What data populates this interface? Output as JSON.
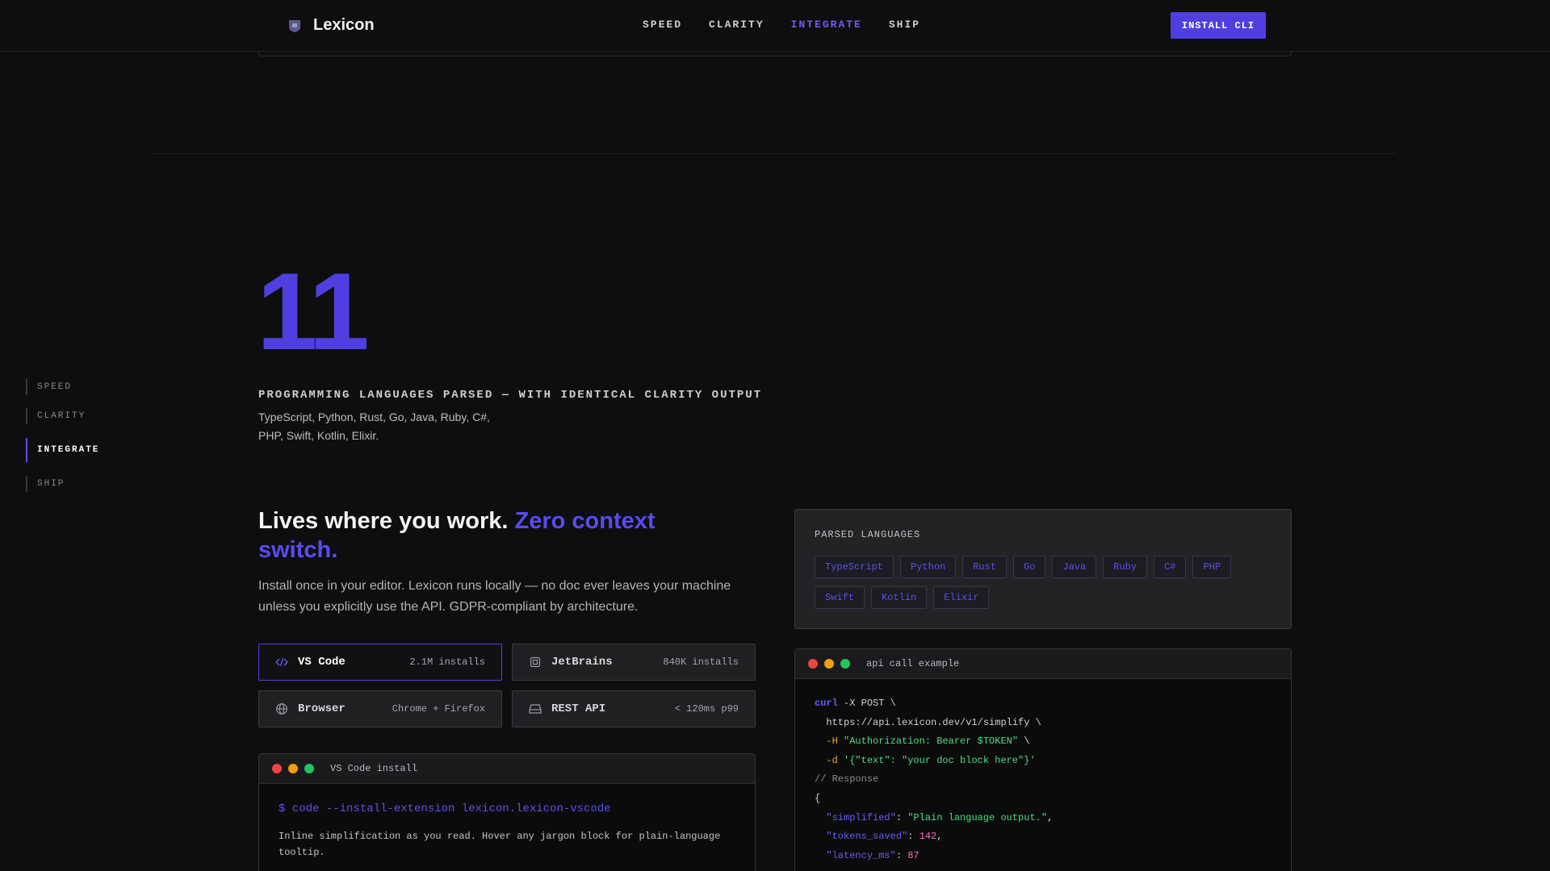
{
  "header": {
    "brand": "Lexicon",
    "nav": [
      "SPEED",
      "CLARITY",
      "INTEGRATE",
      "SHIP"
    ],
    "active_nav": "INTEGRATE",
    "cta": "INSTALL CLI"
  },
  "sidenav": {
    "items": [
      "SPEED",
      "CLARITY",
      "INTEGRATE",
      "SHIP"
    ],
    "active": "INTEGRATE"
  },
  "stat": {
    "number": "11",
    "label": "PROGRAMMING LANGUAGES PARSED — WITH IDENTICAL CLARITY OUTPUT",
    "desc_line1": "TypeScript, Python, Rust, Go, Java, Ruby, C#,",
    "desc_line2": "PHP, Swift, Kotlin, Elixir."
  },
  "section": {
    "headline_plain": "Lives where you work.",
    "headline_accent": "Zero context switch.",
    "lede": "Install once in your editor. Lexicon runs locally — no doc ever leaves your machine unless you explicitly use the API. GDPR-compliant by architecture."
  },
  "integrations": [
    {
      "name": "VS Code",
      "meta": "2.1M installs",
      "icon": "code-icon",
      "active": true
    },
    {
      "name": "JetBrains",
      "meta": "840K installs",
      "icon": "chip-icon",
      "active": false
    },
    {
      "name": "Browser",
      "meta": "Chrome + Firefox",
      "icon": "globe-icon",
      "active": false
    },
    {
      "name": "REST API",
      "meta": "< 120ms p99",
      "icon": "server-icon",
      "active": false
    }
  ],
  "vscode_terminal": {
    "title": "VS Code install",
    "command": "$ code --install-extension lexicon.lexicon-vscode",
    "note": "Inline simplification as you read. Hover any jargon block for plain-language tooltip."
  },
  "languages_panel": {
    "title": "PARSED LANGUAGES",
    "languages": [
      "TypeScript",
      "Python",
      "Rust",
      "Go",
      "Java",
      "Ruby",
      "C#",
      "PHP",
      "Swift",
      "Kotlin",
      "Elixir"
    ]
  },
  "api_terminal": {
    "title": "api call example",
    "curl": "curl",
    "curl_rest": " -X POST \\",
    "url_line": "  https://api.lexicon.dev/v1/simplify \\",
    "h_flag": "-H",
    "h_value": "\"Authorization: Bearer $TOKEN\"",
    "d_flag": "-d",
    "d_value": "'{\"text\": \"your doc block here\"}'",
    "comment": "// Response",
    "brace_open": "{",
    "k1": "\"simplified\"",
    "v1": "\"Plain language output.\"",
    "k2": "\"tokens_saved\"",
    "v2": "142",
    "k3": "\"latency_ms\"",
    "v3": "87"
  },
  "colors": {
    "accent": "#4f3fe0",
    "dot_red": "#ef4444",
    "dot_yellow": "#f59e0b",
    "dot_green": "#22c55e"
  }
}
